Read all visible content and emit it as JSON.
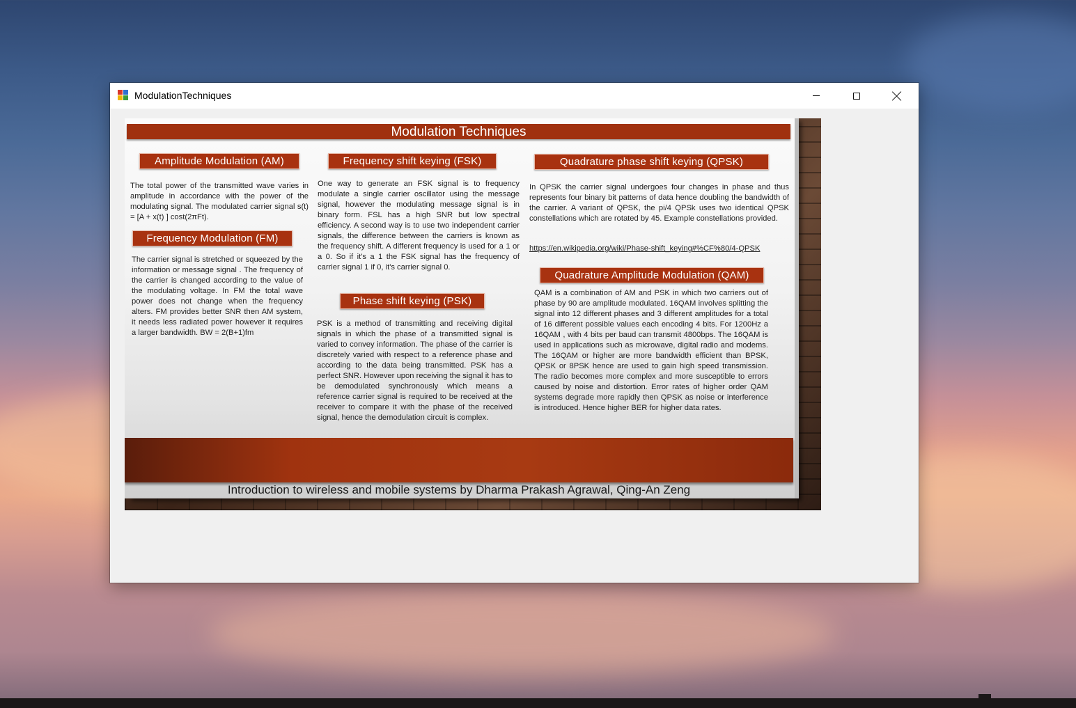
{
  "window": {
    "title": "ModulationTechniques",
    "minimize_symbol": "minimize-icon",
    "maximize_symbol": "maximize-icon",
    "close_symbol": "close-icon"
  },
  "slide": {
    "title": "Modulation Techniques",
    "sections": {
      "am": {
        "heading": "Amplitude  Modulation  (AM)",
        "body": "The total power of the transmitted wave varies in amplitude in accordance with the power of the modulating signal.  The modulated carrier signal s(t) = [A + x(t) ] cost(2πFt)."
      },
      "fm": {
        "heading": "Frequency Modulation (FM)",
        "body": "The carrier signal is stretched or squeezed by the information or message signal . The frequency of the carrier is changed according to the value of the modulating voltage. In FM the total wave power does not change when the frequency alters. FM provides better SNR then AM system, it needs less radiated power however it requires a larger bandwidth.  BW = 2(B+1)fm"
      },
      "fsk": {
        "heading": "Frequency shift keying (FSK)",
        "body": "One way to generate an FSK signal is to frequency modulate a single carrier oscillator using the message signal, however the modulating message signal is in binary form.  FSL has a high SNR but low spectral efficiency.  A second way is to use two independent carrier signals, the difference between the carriers is known as the frequency shift.  A different frequency is used for a 1 or a 0. So if it's a 1 the FSK signal has the frequency of carrier signal 1 if 0, it's carrier signal 0."
      },
      "psk": {
        "heading": "Phase shift keying (PSK)",
        "body": "PSK is a method of transmitting and receiving digital signals in which the phase of a transmitted signal is varied to convey information. The phase of the carrier is discretely varied with respect to a reference phase and according to the data being transmitted.   PSK has a perfect SNR. However upon receiving the signal it has to be demodulated synchronously which means a reference carrier signal is required to be received at the receiver to compare it with the phase of the received signal, hence the demodulation circuit is complex."
      },
      "qpsk": {
        "heading": "Quadrature phase shift keying (QPSK)",
        "body": "In QPSK the carrier signal undergoes four changes in phase and thus represents four binary bit patterns of data hence doubling the bandwidth of the carrier. A variant of QPSK, the pi/4 QPSk uses two identical QPSK constellations which are rotated by 45. Example constellations provided.",
        "link": "https://en.wikipedia.org/wiki/Phase-shift_keying#%CF%80/4-QPSK"
      },
      "qam": {
        "heading": "Quadrature Amplitude Modulation (QAM)",
        "body": "QAM is a combination of AM and PSK in which two carriers out of phase by 90 are amplitude modulated. 16QAM involves splitting the signal into 12 different phases and 3 different amplitudes for a total of 16 different possible values each encoding 4 bits.   For 1200Hz a 16QAM , with 4 bits per baud can transmit 4800bps. The 16QAM is used in applications such as microwave, digital radio and modems. The 16QAM or higher are more bandwidth efficient than BPSK, QPSK or 8PSK hence are used to gain high speed transmission.  The radio becomes more complex and more susceptible to errors caused by noise and distortion. Error rates of higher order QAM systems degrade more rapidly then QPSK as noise or interference is introduced. Hence higher BER for higher data rates."
      }
    },
    "footer": "Introduction to wireless and mobile systems by Dharma Prakash Agrawal, Qing-An Zeng"
  }
}
